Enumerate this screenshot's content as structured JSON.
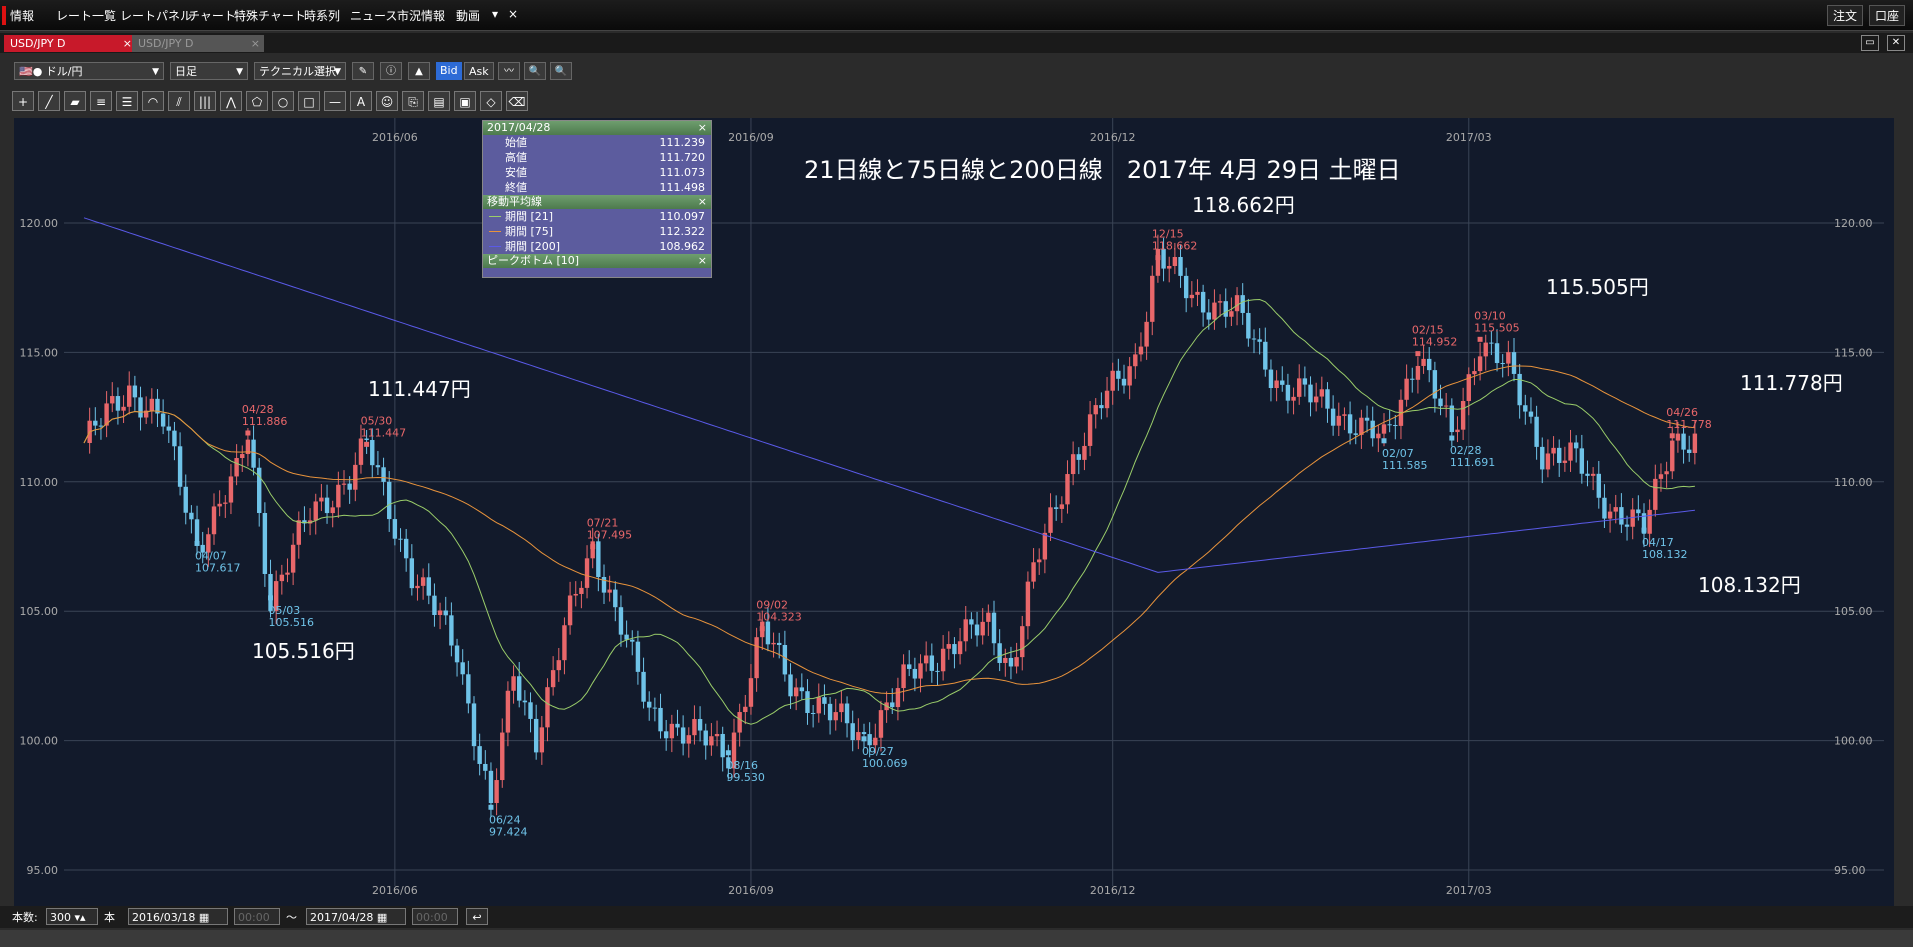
{
  "menubar": {
    "brand": "情報",
    "items": [
      "レート一覧",
      "レートパネル",
      "チャート",
      "特殊チャート",
      "時系列",
      "ニュース",
      "市況情報",
      "動画"
    ],
    "order_label": "注文",
    "account_label": "口座"
  },
  "tabs": [
    {
      "label": "USD/JPY D",
      "active": true
    },
    {
      "label": "USD/JPY D",
      "active": false
    }
  ],
  "toolbar": {
    "pair": "ドル/円",
    "timeframe": "日足",
    "technical": "テクニカル選択",
    "bid": "Bid",
    "ask": "Ask"
  },
  "infobox": {
    "date": "2017/04/28",
    "open_label": "始値",
    "open": "111.239",
    "high_label": "高値",
    "high": "111.720",
    "low_label": "安値",
    "low": "111.073",
    "close_label": "終値",
    "close": "111.498",
    "ma_header": "移動平均線",
    "ma21_label": "期間 [21]",
    "ma21": "110.097",
    "ma75_label": "期間 [75]",
    "ma75": "112.322",
    "ma200_label": "期間 [200]",
    "ma200": "108.962",
    "peak_header": "ピークボトム [10]"
  },
  "chart_title": "21日線と75日線と200日線　2017年 4月 29日 土曜日",
  "chart_data": {
    "type": "candlestick",
    "y_range": [
      95,
      121
    ],
    "y_ticks": [
      "120.00",
      "115.00",
      "110.00",
      "105.00",
      "100.00",
      "95.00"
    ],
    "x_ticks": [
      "2016/06",
      "2016/09",
      "2016/12",
      "2017/03"
    ],
    "date_range": [
      "2016/03/18",
      "2017/04/28"
    ],
    "series": [
      {
        "name": "期間 [21]",
        "color": "#9acd6a"
      },
      {
        "name": "期間 [75]",
        "color": "#e8933c"
      },
      {
        "name": "期間 [200]",
        "color": "#5a5ae8"
      }
    ],
    "peaks": [
      {
        "date": "04/28",
        "value": "111.886",
        "kind": "high"
      },
      {
        "date": "05/30",
        "value": "111.447",
        "kind": "high"
      },
      {
        "date": "07/21",
        "value": "107.495",
        "kind": "high"
      },
      {
        "date": "09/02",
        "value": "104.323",
        "kind": "high"
      },
      {
        "date": "12/15",
        "value": "118.662",
        "kind": "high"
      },
      {
        "date": "02/15",
        "value": "114.952",
        "kind": "high"
      },
      {
        "date": "03/10",
        "value": "115.505",
        "kind": "high"
      },
      {
        "date": "04/26",
        "value": "111.778",
        "kind": "high"
      },
      {
        "date": "04/07",
        "value": "107.617",
        "kind": "low"
      },
      {
        "date": "05/03",
        "value": "105.516",
        "kind": "low"
      },
      {
        "date": "06/24",
        "value": "97.424",
        "kind": "low"
      },
      {
        "date": "08/16",
        "value": "99.530",
        "kind": "low"
      },
      {
        "date": "09/27",
        "value": "100.069",
        "kind": "low"
      },
      {
        "date": "02/07",
        "value": "111.585",
        "kind": "low"
      },
      {
        "date": "02/28",
        "value": "111.691",
        "kind": "low"
      },
      {
        "date": "04/17",
        "value": "108.132",
        "kind": "low"
      }
    ],
    "annotations": [
      "111.447円",
      "105.516円",
      "118.662円",
      "115.505円",
      "111.778円",
      "108.132円"
    ]
  },
  "status": {
    "count_label": "本数:",
    "count": "300",
    "unit": "本",
    "from": "2016/03/18",
    "to": "2017/04/28",
    "tilde": "～",
    "time": "00:00"
  },
  "colors": {
    "up": "#e8676a",
    "down": "#6fc3e8",
    "bg": "#121a2b",
    "peak_high": "#e8676a",
    "peak_low": "#6fc3e8"
  }
}
